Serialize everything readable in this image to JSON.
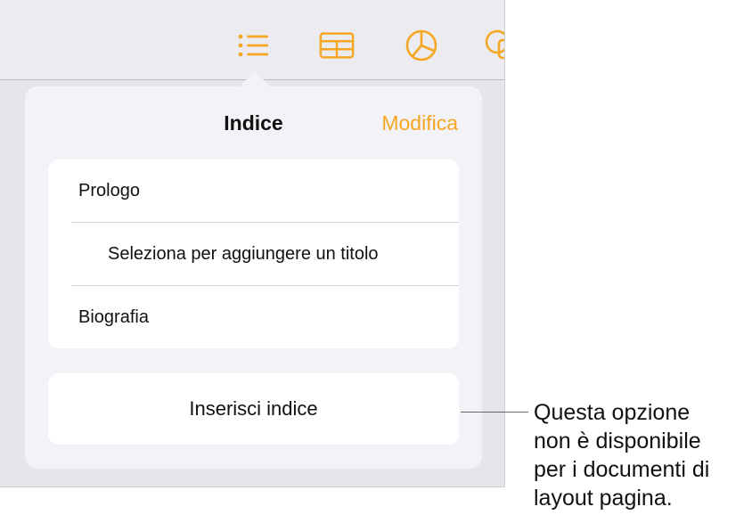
{
  "toolbar": {
    "buttons": [
      {
        "icon": "list-icon",
        "active": true
      },
      {
        "icon": "table-icon",
        "active": false
      },
      {
        "icon": "chart-icon",
        "active": false
      },
      {
        "icon": "shape-icon",
        "active": false
      }
    ]
  },
  "popover": {
    "title": "Indice",
    "edit_label": "Modifica",
    "rows": [
      {
        "label": "Prologo",
        "indent": 0
      },
      {
        "label": "Seleziona per aggiungere un titolo",
        "indent": 1
      },
      {
        "label": "Biografia",
        "indent": 0
      }
    ],
    "insert_label": "Inserisci indice"
  },
  "callout": {
    "lines": [
      "Questa opzione",
      "non è disponibile",
      "per i documenti di",
      "layout pagina."
    ]
  },
  "colors": {
    "accent": "#f5a623",
    "text": "#111111",
    "popover_bg": "#f2f2f7",
    "screen_bg": "#e5e5ea"
  }
}
